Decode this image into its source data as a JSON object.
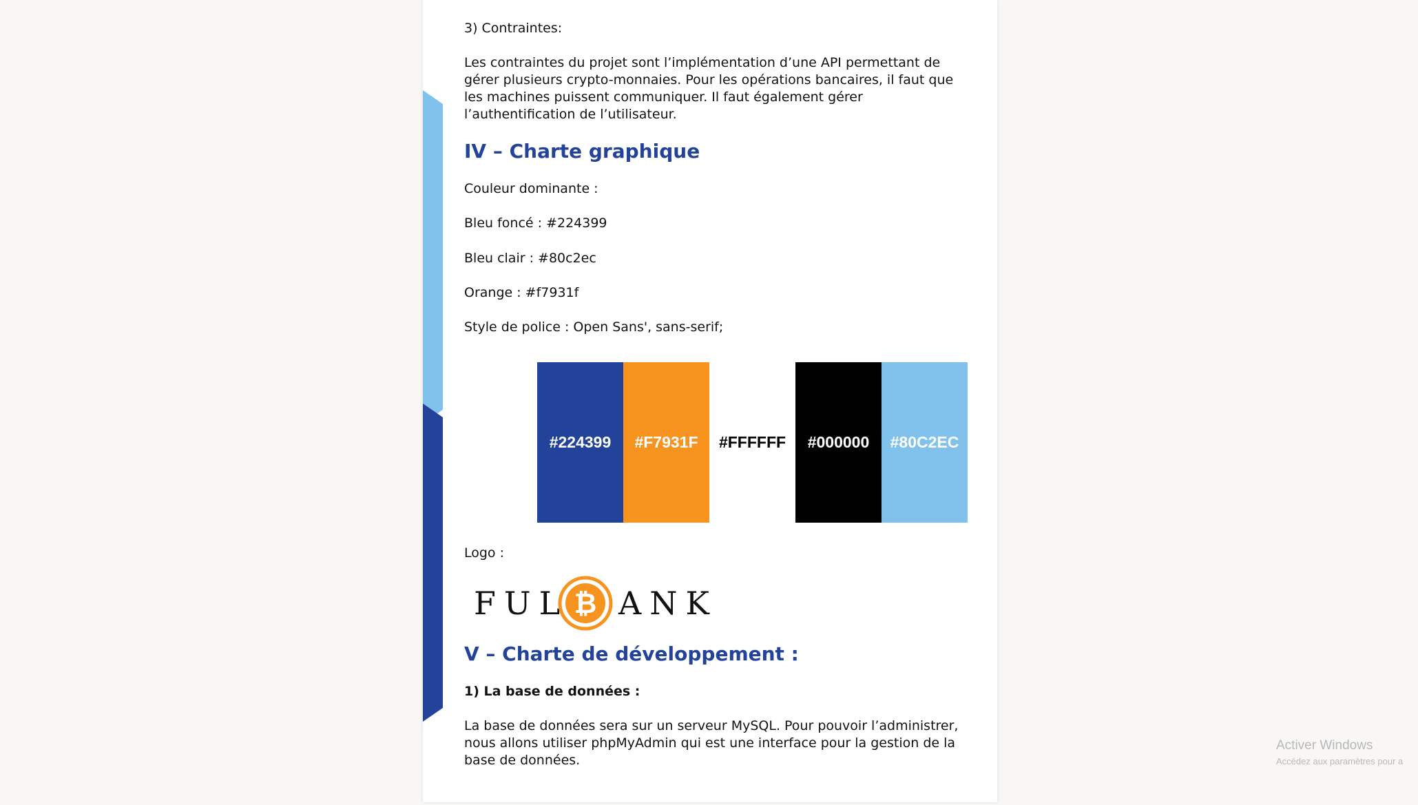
{
  "document": {
    "section3_heading": "3) Contraintes:",
    "section3_lines": [
      "Les contraintes du projet sont l’implémentation d’une API permettant de",
      "gérer plusieurs crypto-monnaies. Pour les opérations bancaires, il faut que",
      "les machines puissent communiquer. Il faut également gérer",
      "l’authentification de l’utilisateur."
    ],
    "heading_iv": "IV – Charte graphique",
    "couleur_dominante": "Couleur dominante :",
    "bleu_fonce": "Bleu foncé : #224399",
    "bleu_clair": "Bleu clair : #80c2ec",
    "orange": "Orange : #f7931f",
    "style_police": "Style de police : Open Sans', sans-serif;",
    "swatches": [
      {
        "label": "#224399",
        "bg": "#224399",
        "fg": "#ffffff"
      },
      {
        "label": "#F7931F",
        "bg": "#f7931f",
        "fg": "#ffffff"
      },
      {
        "label": "#FFFFFF",
        "bg": "#ffffff",
        "fg": "#000000"
      },
      {
        "label": "#000000",
        "bg": "#000000",
        "fg": "#ffffff"
      },
      {
        "label": "#80C2EC",
        "bg": "#80c2ec",
        "fg": "#ffffff"
      }
    ],
    "logo_label": "Logo :",
    "logo": {
      "left": "FUL",
      "right": "ANK",
      "coin_symbol": "₿",
      "coin_color": "#f7931f"
    },
    "heading_v": "V – Charte de développement :",
    "db_heading": "1) La base de données :",
    "db_lines": [
      "La base de données sera sur un serveur MySQL. Pour pouvoir l’administrer,",
      "nous allons utiliser phpMyAdmin qui est une interface pour la gestion de la",
      "base de données."
    ]
  },
  "watermark": {
    "title": "Activer Windows",
    "subtitle": "Accédez aux paramètres pour a"
  }
}
